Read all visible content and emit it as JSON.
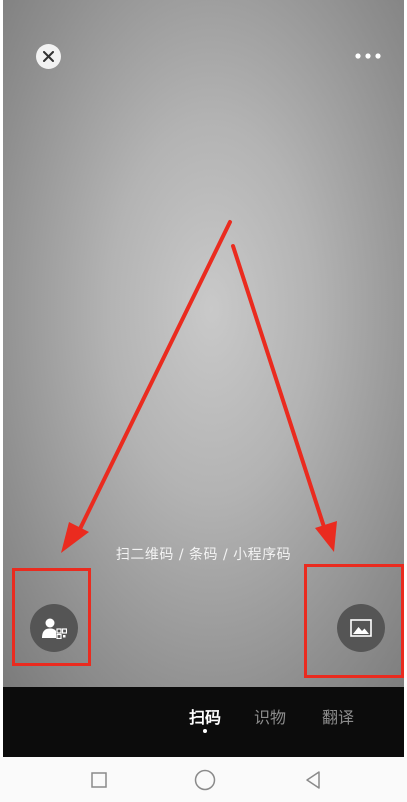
{
  "scanner": {
    "hint_text": "扫二维码 / 条码 / 小程序码"
  },
  "top_bar": {
    "close_icon": "close-icon",
    "more_icon": "more-icon"
  },
  "bottom_actions": {
    "left_icon": "my-qr-code-icon",
    "right_icon": "album-icon"
  },
  "mode_tabs": [
    {
      "label": "扫码",
      "active": true
    },
    {
      "label": "识物",
      "active": false
    },
    {
      "label": "翻译",
      "active": false
    }
  ],
  "system_nav": {
    "recent_icon": "square-recent-icon",
    "home_icon": "circle-home-icon",
    "back_icon": "triangle-back-icon"
  },
  "colors": {
    "annotation": "#ea2b1f",
    "modebar_bg": "#0c0c0c",
    "active_tab": "#ffffff",
    "inactive_tab": "#8c8c8c"
  }
}
